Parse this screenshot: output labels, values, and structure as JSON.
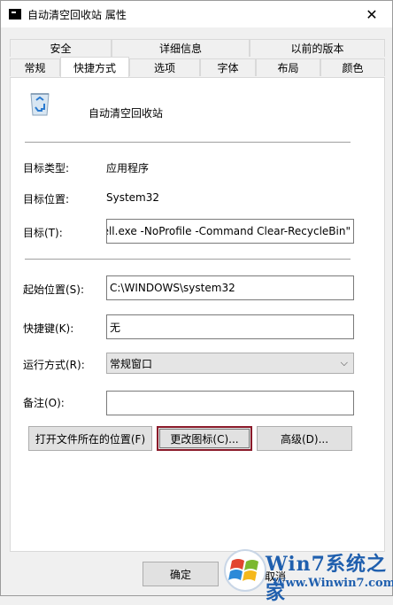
{
  "window": {
    "title": "自动清空回收站 属性",
    "close_glyph": "✕"
  },
  "tabs": {
    "row1": [
      "安全",
      "详细信息",
      "以前的版本"
    ],
    "row2": [
      "常规",
      "快捷方式",
      "选项",
      "字体",
      "布局",
      "颜色"
    ],
    "active": "快捷方式"
  },
  "shortcut": {
    "name": "自动清空回收站",
    "icon": "recycle-bin-icon",
    "target_type_label": "目标类型:",
    "target_type_value": "应用程序",
    "target_location_label": "目标位置:",
    "target_location_value": "System32",
    "target_label": "目标(T):",
    "target_value": "ell.exe -NoProfile -Command Clear-RecycleBin\"",
    "start_in_label": "起始位置(S):",
    "start_in_value": "C:\\WINDOWS\\system32",
    "hotkey_label": "快捷键(K):",
    "hotkey_value": "无",
    "run_label": "运行方式(R):",
    "run_value": "常规窗口",
    "comment_label": "备注(O):",
    "comment_value": ""
  },
  "buttons": {
    "open_location": "打开文件所在的位置(F)",
    "change_icon": "更改图标(C)...",
    "advanced": "高级(D)...",
    "ok": "确定",
    "cancel_partial": "取消"
  },
  "watermark": {
    "line1": "Win7系统之家",
    "line2": "Www.Winwin7.com"
  },
  "colors": {
    "focus_border": "#8b1a2a",
    "watermark_blue": "#1f5fae"
  }
}
